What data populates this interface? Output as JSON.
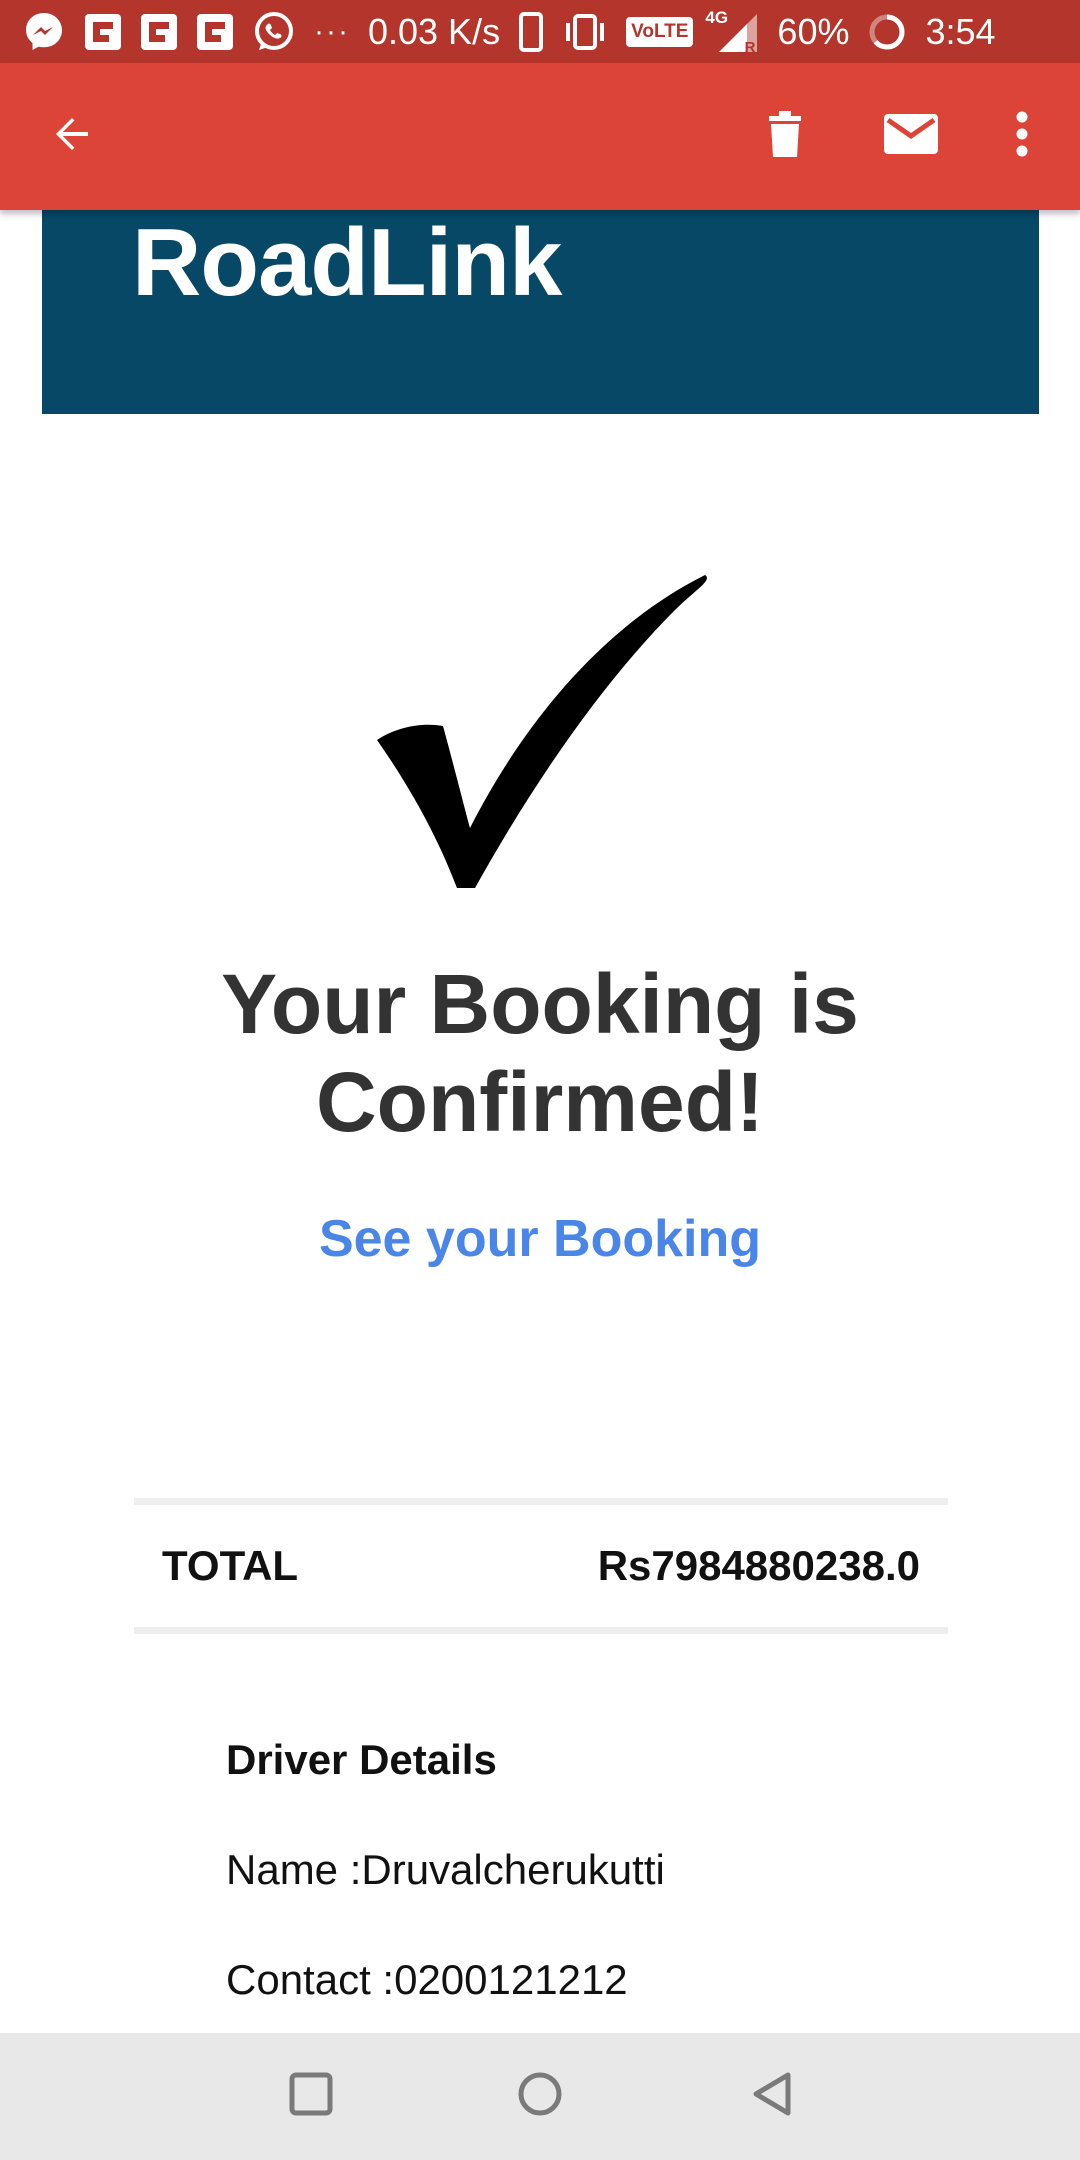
{
  "status_bar": {
    "icons": [
      "messenger-icon",
      "flipboard-icon",
      "flipboard-icon",
      "flipboard-icon",
      "whatsapp-icon",
      "more-notifications-icon"
    ],
    "net_speed": "0.03 K/s",
    "volte": "VoLTE",
    "network": "4G",
    "roaming": "R",
    "battery": "60%",
    "time": "3:54"
  },
  "app_bar": {
    "icons": {
      "back": "arrow-back-icon",
      "delete": "trash-icon",
      "mail": "mail-icon",
      "more": "more-vert-icon"
    }
  },
  "email": {
    "brand": "RoadLink",
    "confirm_title": "Your Booking is Confirmed!",
    "see_booking_link": "See your Booking",
    "total_label": "TOTAL",
    "total_value": "Rs7984880238.0",
    "driver_heading": "Driver Details",
    "driver_name": "Name :Druvalcherukutti",
    "driver_contact": "Contact :0200121212"
  },
  "colors": {
    "status_bar": "#b3352b",
    "app_bar": "#db4437",
    "banner": "#064866",
    "link": "#4a86e8",
    "title": "#333333"
  }
}
